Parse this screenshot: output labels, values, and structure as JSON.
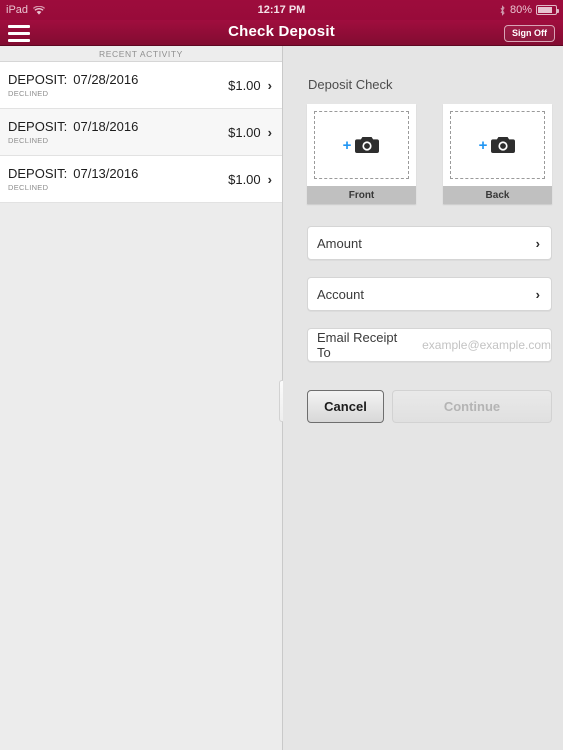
{
  "status_bar": {
    "device": "iPad",
    "wifi_icon": "wifi-icon",
    "time": "12:17 PM",
    "bluetooth_icon": "bluetooth-icon",
    "battery_percent": "80%",
    "battery_icon": "battery-icon"
  },
  "nav_bar": {
    "menu_icon": "hamburger-menu-icon",
    "title": "Check Deposit",
    "sign_off_label": "Sign Off",
    "brand_color": "#9d0c3c"
  },
  "left_pane": {
    "section_header": "RECENT ACTIVITY",
    "rows": [
      {
        "kind": "DEPOSIT:",
        "date": "07/28/2016",
        "status": "DECLINED",
        "amount": "$1.00",
        "chevron": "›"
      },
      {
        "kind": "DEPOSIT:",
        "date": "07/18/2016",
        "status": "DECLINED",
        "amount": "$1.00",
        "chevron": "›"
      },
      {
        "kind": "DEPOSIT:",
        "date": "07/13/2016",
        "status": "DECLINED",
        "amount": "$1.00",
        "chevron": "›"
      }
    ]
  },
  "split_handle": {
    "icon": "drag-handle-icon"
  },
  "right_pane": {
    "section_title": "Deposit Check",
    "capture_tiles": [
      {
        "label": "Front",
        "plus": "+",
        "camera_icon": "camera-icon"
      },
      {
        "label": "Back",
        "plus": "+",
        "camera_icon": "camera-icon"
      }
    ],
    "fields": {
      "amount": {
        "label": "Amount",
        "chevron": "›"
      },
      "account": {
        "label": "Account",
        "chevron": "›"
      },
      "email": {
        "label": "Email Receipt To",
        "placeholder": "example@example.com",
        "value": ""
      }
    },
    "buttons": {
      "cancel": "Cancel",
      "continue": "Continue"
    }
  }
}
